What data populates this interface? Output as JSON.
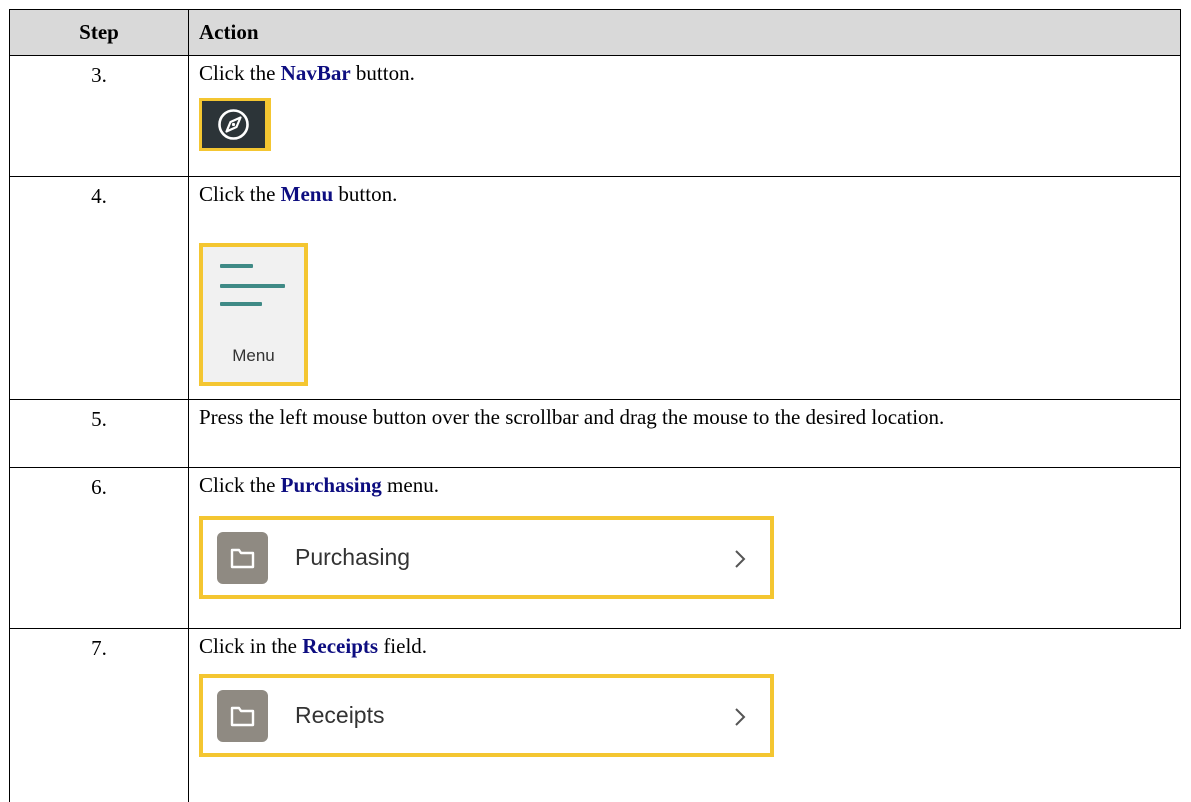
{
  "table": {
    "headers": {
      "step": "Step",
      "action": "Action"
    },
    "rows": [
      {
        "step": "3.",
        "pre": "Click the ",
        "keyword": "NavBar",
        "post": " button."
      },
      {
        "step": "4.",
        "pre": "Click the ",
        "keyword": "Menu",
        "post": " button."
      },
      {
        "step": "5.",
        "text": "Press the left mouse button over the scrollbar and drag the mouse to the desired location."
      },
      {
        "step": "6.",
        "pre": "Click the ",
        "keyword": "Purchasing",
        "post": " menu."
      },
      {
        "step": "7.",
        "pre": "Click in the ",
        "keyword": "Receipts",
        "post": " field."
      }
    ]
  },
  "images": {
    "navbar": {
      "icon": "compass-icon"
    },
    "menu": {
      "icon": "hamburger-menu-icon",
      "label": "Menu"
    },
    "purchasing": {
      "icon": "folder-icon",
      "label": "Purchasing",
      "chevron": "chevron-right-icon"
    },
    "receipts": {
      "icon": "folder-icon",
      "label": "Receipts",
      "chevron": "chevron-right-icon"
    }
  },
  "colors": {
    "keyword": "#0d0d80",
    "highlight": "#f4c631",
    "header_bg": "#d9d9d9",
    "navbar_bg": "#2c3438",
    "menu_accent": "#3f8a86",
    "folder_bg": "#8f8a82"
  }
}
